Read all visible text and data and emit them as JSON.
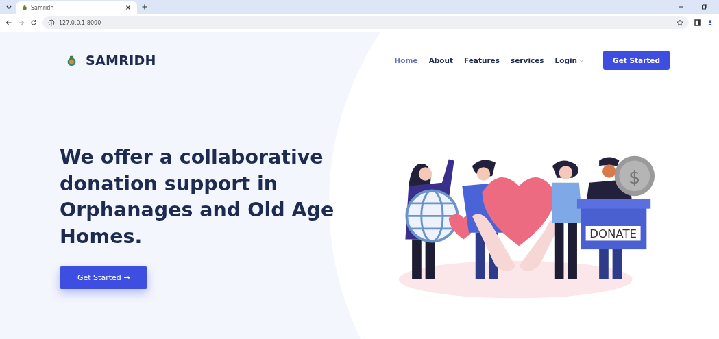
{
  "browser": {
    "tab_title": "Samridh",
    "address": "127.0.0.1:8000"
  },
  "brand": {
    "name": "SAMRIDH"
  },
  "nav": [
    {
      "label": "Home",
      "selected": true,
      "kind": "link"
    },
    {
      "label": "About",
      "selected": false,
      "kind": "link"
    },
    {
      "label": "Features",
      "selected": false,
      "kind": "link"
    },
    {
      "label": "services",
      "selected": false,
      "kind": "link"
    },
    {
      "label": "Login",
      "selected": false,
      "kind": "dropdown"
    }
  ],
  "nav_button": "Get Started",
  "hero": {
    "headline": "We offer a collaborative donation support in Orphanages and Old Age Homes.",
    "button": "Get Started →"
  },
  "illustration": {
    "box_label": "DONATE",
    "coin_symbol": "$"
  }
}
